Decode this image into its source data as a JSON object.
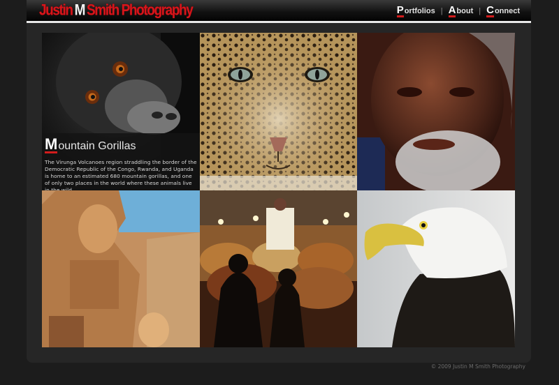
{
  "brand": {
    "part1": "Justin",
    "part2": "M",
    "part3": "Smith Photography"
  },
  "nav": {
    "items": [
      {
        "initial": "P",
        "rest": "ortfolios"
      },
      {
        "initial": "A",
        "rest": "bout"
      },
      {
        "initial": "C",
        "rest": "onnect"
      }
    ],
    "separator": "|"
  },
  "featured": {
    "title_initial": "M",
    "title_rest": "ountain Gorillas",
    "description": "The Virunga Volcanoes region straddling the border of the Democratic Republic of the Congo, Rwanda, and Uganda is home to an estimated 680 mountain gorillas, and one of only two places in the world where these animals live in the wild."
  },
  "gallery": [
    {
      "subject": "gorilla"
    },
    {
      "subject": "leopard"
    },
    {
      "subject": "elder-portrait"
    },
    {
      "subject": "egyptian-statue"
    },
    {
      "subject": "market-stall"
    },
    {
      "subject": "bald-eagle"
    }
  ],
  "footer": {
    "copyright": "© 2009 Justin M Smith Photography"
  },
  "colors": {
    "accent": "#d21c1c",
    "background": "#1c1c1c",
    "panel": "#262626"
  }
}
